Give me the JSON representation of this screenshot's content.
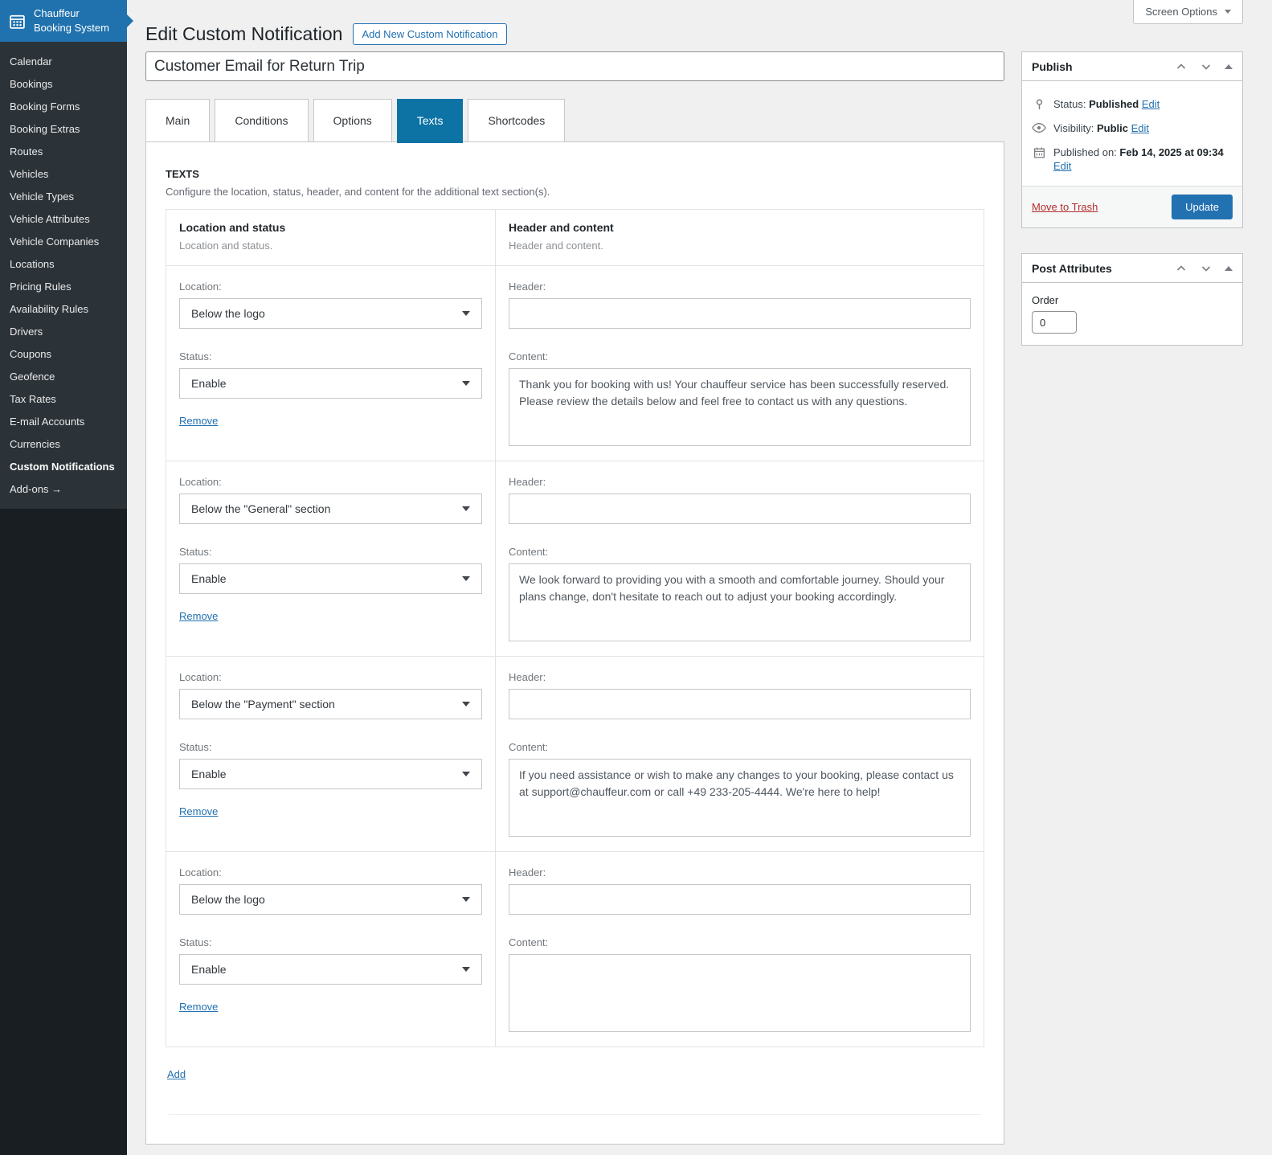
{
  "colors": {
    "accent_blue": "#2271b1",
    "active_tab_blue": "#0c73a4",
    "brand_header_blue": "#1f72ae",
    "sidebar_bg": "#2c3338",
    "sidebar_bg_dark": "#191e23",
    "trash_red": "#b32d2e",
    "page_bg": "#f0f0f1"
  },
  "icons": {
    "brand": "calendar-icon",
    "status": "pin-icon",
    "visibility": "eye-icon",
    "published_on": "calendar-icon",
    "selects": "chevron-down-icon",
    "screen_options": "chevron-down-icon",
    "postbox_controls": [
      "chevron-up-icon",
      "chevron-down-icon",
      "triangle-up-icon"
    ]
  },
  "sidebar": {
    "brand": {
      "line1": "Chauffeur",
      "line2": "Booking System"
    },
    "items": [
      "Calendar",
      "Bookings",
      "Booking Forms",
      "Booking Extras",
      "Routes",
      "Vehicles",
      "Vehicle Types",
      "Vehicle Attributes",
      "Vehicle Companies",
      "Locations",
      "Pricing Rules",
      "Availability Rules",
      "Drivers",
      "Coupons",
      "Geofence",
      "Tax Rates",
      "E-mail Accounts",
      "Currencies",
      "Custom Notifications",
      "Add-ons →"
    ],
    "active_item": "Custom Notifications"
  },
  "header": {
    "title": "Edit Custom Notification",
    "add_new_button": "Add New Custom Notification",
    "screen_options": "Screen Options"
  },
  "editor": {
    "post_title": "Customer Email for Return Trip"
  },
  "tabs": [
    {
      "label": "Main",
      "active": false
    },
    {
      "label": "Conditions",
      "active": false
    },
    {
      "label": "Options",
      "active": false
    },
    {
      "label": "Texts",
      "active": true
    },
    {
      "label": "Shortcodes",
      "active": false
    }
  ],
  "texts_tab": {
    "section_title": "TEXTS",
    "section_description": "Configure the location, status, header, and content for the additional text section(s).",
    "columns": {
      "left": {
        "title": "Location and status",
        "subtitle": "Location and status."
      },
      "right": {
        "title": "Header and content",
        "subtitle": "Header and content."
      }
    },
    "labels": {
      "location": "Location:",
      "status": "Status:",
      "header": "Header:",
      "content": "Content:",
      "remove": "Remove",
      "add": "Add"
    },
    "rows": [
      {
        "location": "Below the logo",
        "status": "Enable",
        "header": "",
        "content": "Thank you for booking with us! Your chauffeur service has been successfully reserved. Please review the details below and feel free to contact us with any questions."
      },
      {
        "location": "Below the \"General\" section",
        "status": "Enable",
        "header": "",
        "content": "We look forward to providing you with a smooth and comfortable journey. Should your plans change, don't hesitate to reach out to adjust your booking accordingly."
      },
      {
        "location": "Below the \"Payment\" section",
        "status": "Enable",
        "header": "",
        "content": "If you need assistance or wish to make any changes to your booking, please contact us at support@chauffeur.com or call +49 233-205-4444. We're here to help!"
      },
      {
        "location": "Below the logo",
        "status": "Enable",
        "header": "",
        "content": ""
      }
    ]
  },
  "publish": {
    "title": "Publish",
    "status_label": "Status:",
    "status_value": "Published",
    "visibility_label": "Visibility:",
    "visibility_value": "Public",
    "published_label": "Published on:",
    "published_value": "Feb 14, 2025 at 09:34",
    "edit_label": "Edit",
    "move_to_trash": "Move to Trash",
    "update_button": "Update"
  },
  "post_attributes": {
    "title": "Post Attributes",
    "order_label": "Order",
    "order_value": "0"
  }
}
